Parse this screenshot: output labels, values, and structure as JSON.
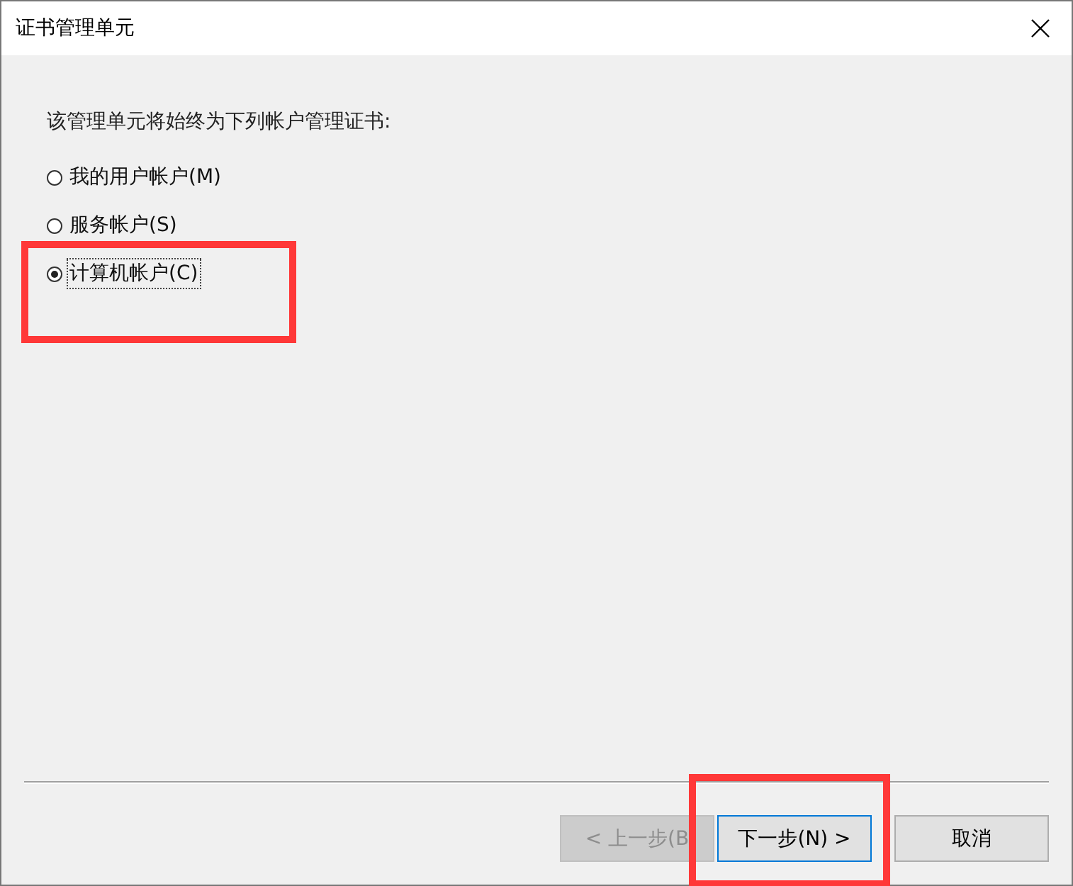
{
  "window": {
    "title": "证书管理单元"
  },
  "prompt": "该管理单元将始终为下列帐户管理证书:",
  "options": [
    {
      "label": "我的用户帐户(M)",
      "selected": false
    },
    {
      "label": "服务帐户(S)",
      "selected": false
    },
    {
      "label": "计算机帐户(C)",
      "selected": true
    }
  ],
  "buttons": [
    {
      "label": "< 上一步(B",
      "disabled": true,
      "focused": false
    },
    {
      "label": "下一步(N) >",
      "disabled": false,
      "focused": true
    },
    {
      "label": "取消",
      "disabled": false,
      "focused": false
    }
  ]
}
